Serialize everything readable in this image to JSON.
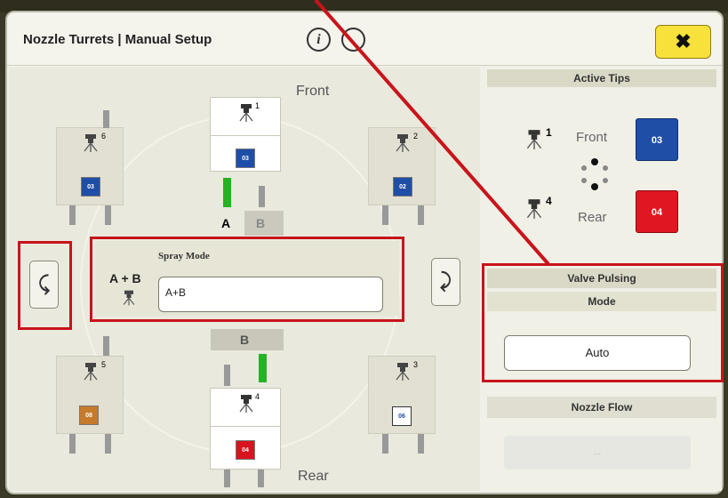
{
  "dialog": {
    "title": "Nozzle Turrets | Manual Setup",
    "info_symbol": "i",
    "close_symbol": "✖"
  },
  "turret_view": {
    "front_label": "Front",
    "rear_label": "Rear",
    "rotate_left_symbol": "⤹",
    "rotate_right_symbol": "⤸",
    "section_a": "A",
    "section_b": "B",
    "section_b_lower": "B",
    "turrets": [
      {
        "position": "1",
        "sprayer_glyph": "😎",
        "tip_label": "03",
        "tip_color": "#1f4ea7"
      },
      {
        "position": "2",
        "sprayer_glyph": "😎",
        "tip_label": "02",
        "tip_color": "#1f4ea7"
      },
      {
        "position": "3",
        "sprayer_glyph": "😎",
        "tip_label": "06",
        "tip_color": "#ffffff"
      },
      {
        "position": "4",
        "sprayer_glyph": "😎",
        "tip_label": "04",
        "tip_color": "#d9121f"
      },
      {
        "position": "5",
        "sprayer_glyph": "😎",
        "tip_label": "08",
        "tip_color": "#c57a2c"
      },
      {
        "position": "6",
        "sprayer_glyph": "😎",
        "tip_label": "03",
        "tip_color": "#1f4ea7"
      }
    ],
    "pipe_active_color": "#22b422",
    "pipe_inactive_color": "#a9a9a9"
  },
  "spray_mode": {
    "title": "Spray Mode",
    "icon_label": "A + B",
    "value": "A+B"
  },
  "active_tips": {
    "header": "Active Tips",
    "front": {
      "position": "1",
      "label": "Front",
      "tip": "03",
      "color": "#1f4ea7"
    },
    "rear": {
      "position": "4",
      "label": "Rear",
      "tip": "04",
      "color": "#e01722"
    }
  },
  "valve_pulsing": {
    "header": "Valve Pulsing",
    "mode_label": "Mode",
    "mode_value": "Auto"
  },
  "nozzle_flow": {
    "header": "Nozzle Flow",
    "value": "..."
  },
  "annotation_color": "#c8141a"
}
